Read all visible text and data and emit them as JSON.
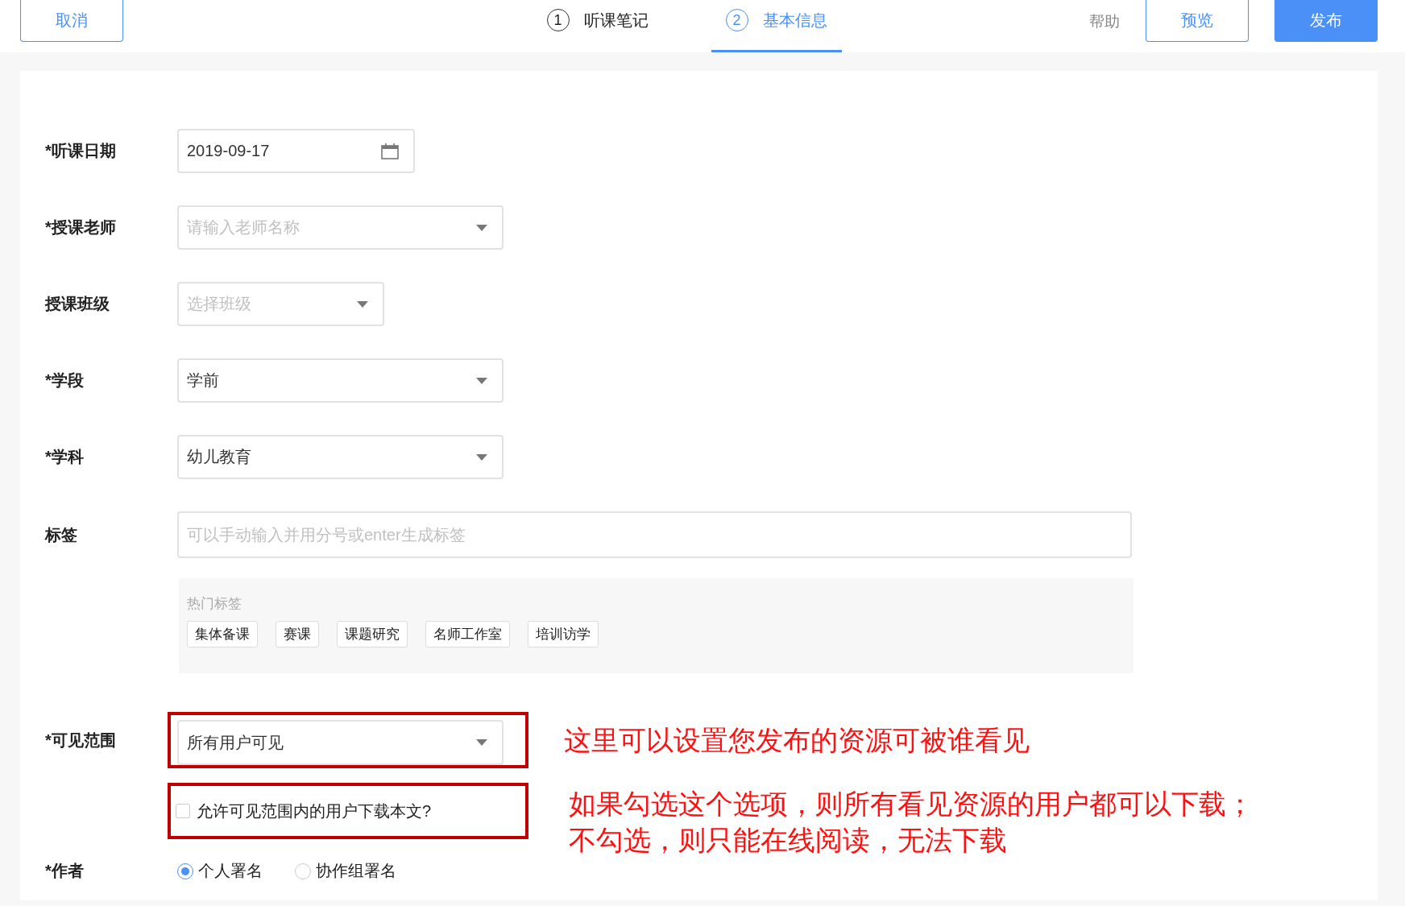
{
  "header": {
    "cancel_button": "取消",
    "steps": [
      {
        "number": "1",
        "label": "听课笔记",
        "selected": false
      },
      {
        "number": "2",
        "label": "基本信息",
        "selected": true
      }
    ],
    "help_link": "帮助",
    "preview_button": "预览",
    "publish_button": "发布"
  },
  "fields": [
    {
      "kind": "date",
      "label": "*听课日期",
      "value": "2019-09-17"
    },
    {
      "kind": "select",
      "label": "*授课老师",
      "placeholder": "请输入老师名称"
    },
    {
      "kind": "select",
      "label": "授课班级",
      "placeholder": "选择班级"
    },
    {
      "kind": "select",
      "label": "*学段",
      "value": "学前"
    },
    {
      "kind": "select",
      "label": "*学科",
      "value": "幼儿教育"
    },
    {
      "kind": "text",
      "label": "标签",
      "placeholder": "可以手动输入并用分号或enter生成标签"
    }
  ],
  "hot_tags": {
    "title": "热门标签",
    "tags": [
      "集体备课",
      "赛课",
      "课题研究",
      "名师工作室",
      "培训访学"
    ]
  },
  "visibility": {
    "label": "*可见范围",
    "value": "所有用户可见",
    "highlighted": true,
    "annotation": [
      "这里可以设置您发布的资源可被谁看见"
    ]
  },
  "download": {
    "label": "允许可见范围内的用户下载本文?",
    "checked": false,
    "highlighted": true,
    "annotation": [
      "如果勾选这个选项，则所有看见资源的用户都可以下载；",
      "不勾选，则只能在线阅读，无法下载"
    ]
  },
  "author": {
    "label": "*作者",
    "options": [
      {
        "label": "个人署名",
        "selected": true
      },
      {
        "label": "协作组署名",
        "selected": false
      }
    ]
  }
}
